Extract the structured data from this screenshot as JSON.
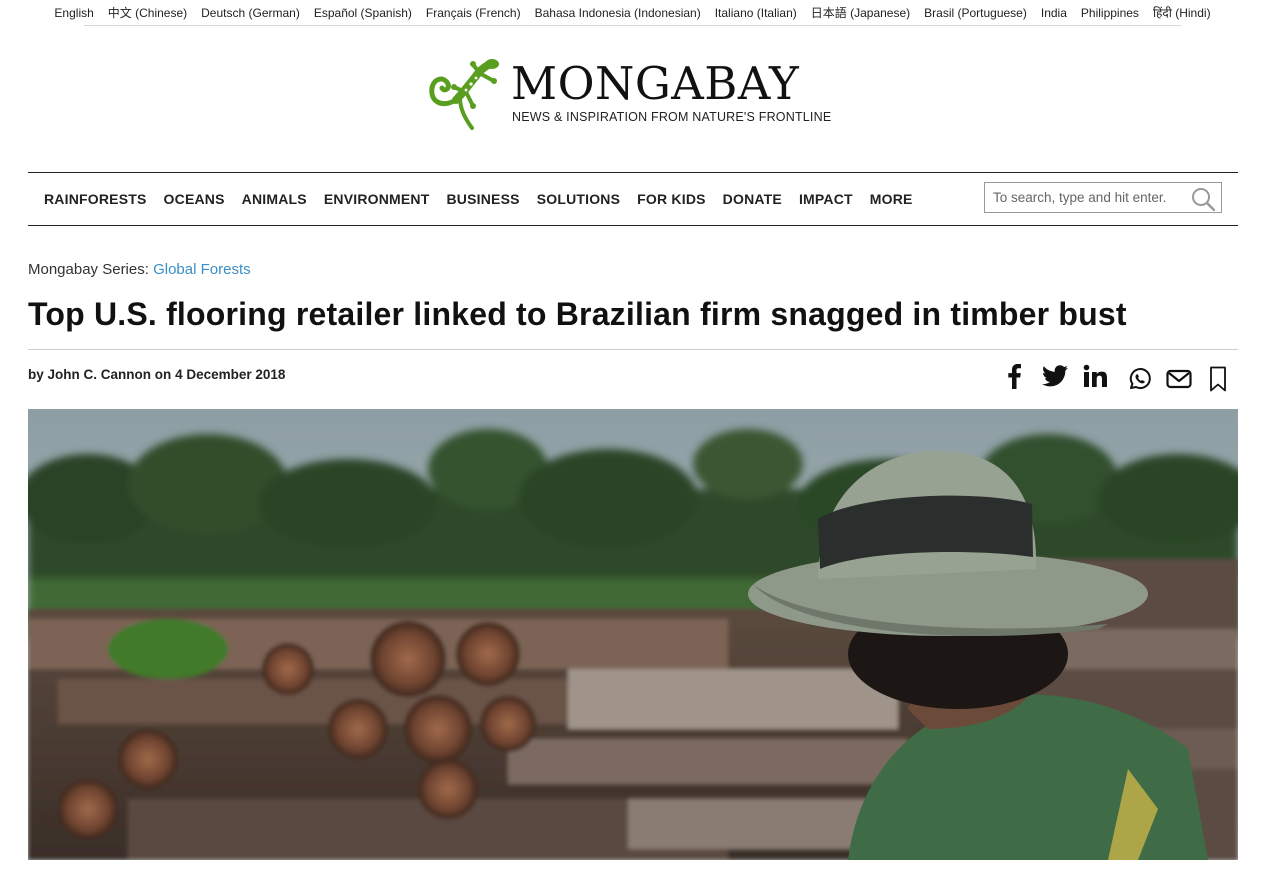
{
  "languages": [
    "English",
    "中文 (Chinese)",
    "Deutsch (German)",
    "Español (Spanish)",
    "Français (French)",
    "Bahasa Indonesia (Indonesian)",
    "Italiano (Italian)",
    "日本語 (Japanese)",
    "Brasil (Portuguese)",
    "India",
    "Philippines",
    "हिंदी (Hindi)"
  ],
  "logo": {
    "brand": "MONGABAY",
    "tagline": "NEWS & INSPIRATION FROM NATURE'S FRONTLINE"
  },
  "nav": {
    "items": [
      "RAINFORESTS",
      "OCEANS",
      "ANIMALS",
      "ENVIRONMENT",
      "BUSINESS",
      "SOLUTIONS",
      "FOR KIDS",
      "DONATE",
      "IMPACT",
      "MORE"
    ],
    "search_placeholder": "To search, type and hit enter."
  },
  "article": {
    "series_label": "Mongabay Series:",
    "series_link": "Global Forests",
    "title": "Top U.S. flooring retailer linked to Brazilian firm snagged in timber bust",
    "by": "by",
    "author": "John C. Cannon",
    "on": "on",
    "date": "4 December 2018"
  },
  "share_icons": [
    "facebook-icon",
    "twitter-icon",
    "linkedin-icon",
    "whatsapp-icon",
    "email-icon",
    "bookmark-icon"
  ],
  "colors": {
    "link_accent": "#3b8fc4",
    "gecko_green": "#5a9e1f"
  }
}
